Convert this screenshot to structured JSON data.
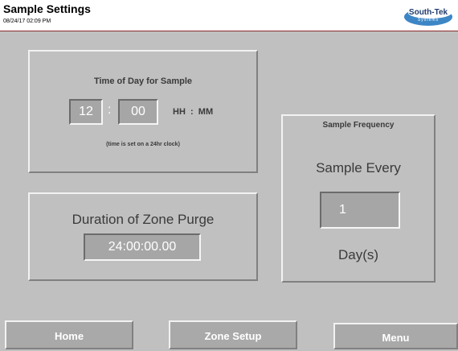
{
  "header": {
    "title": "Sample Settings",
    "datetime": "08/24/17  02:09 PM",
    "logo_text": "South-Tek",
    "logo_sub": "Systems"
  },
  "time_of_day": {
    "title": "Time of Day for Sample",
    "hour": "12",
    "separator": ":",
    "minute": "00",
    "format_label": "HH  :  MM",
    "note": "(time is set on a 24hr clock)"
  },
  "zone_purge": {
    "title": "Duration of Zone Purge",
    "value": "24:00:00.00"
  },
  "sample_frequency": {
    "title": "Sample Frequency",
    "subtitle": "Sample Every",
    "value": "1",
    "unit": "Day(s)"
  },
  "footer": {
    "home_label": "Home",
    "zone_setup_label": "Zone Setup",
    "menu_label": "Menu"
  },
  "colors": {
    "background": "#c0c0c0",
    "header_border": "#8c2a2a",
    "field_background": "#a6a6a6",
    "button_background": "#a9a9a9"
  }
}
